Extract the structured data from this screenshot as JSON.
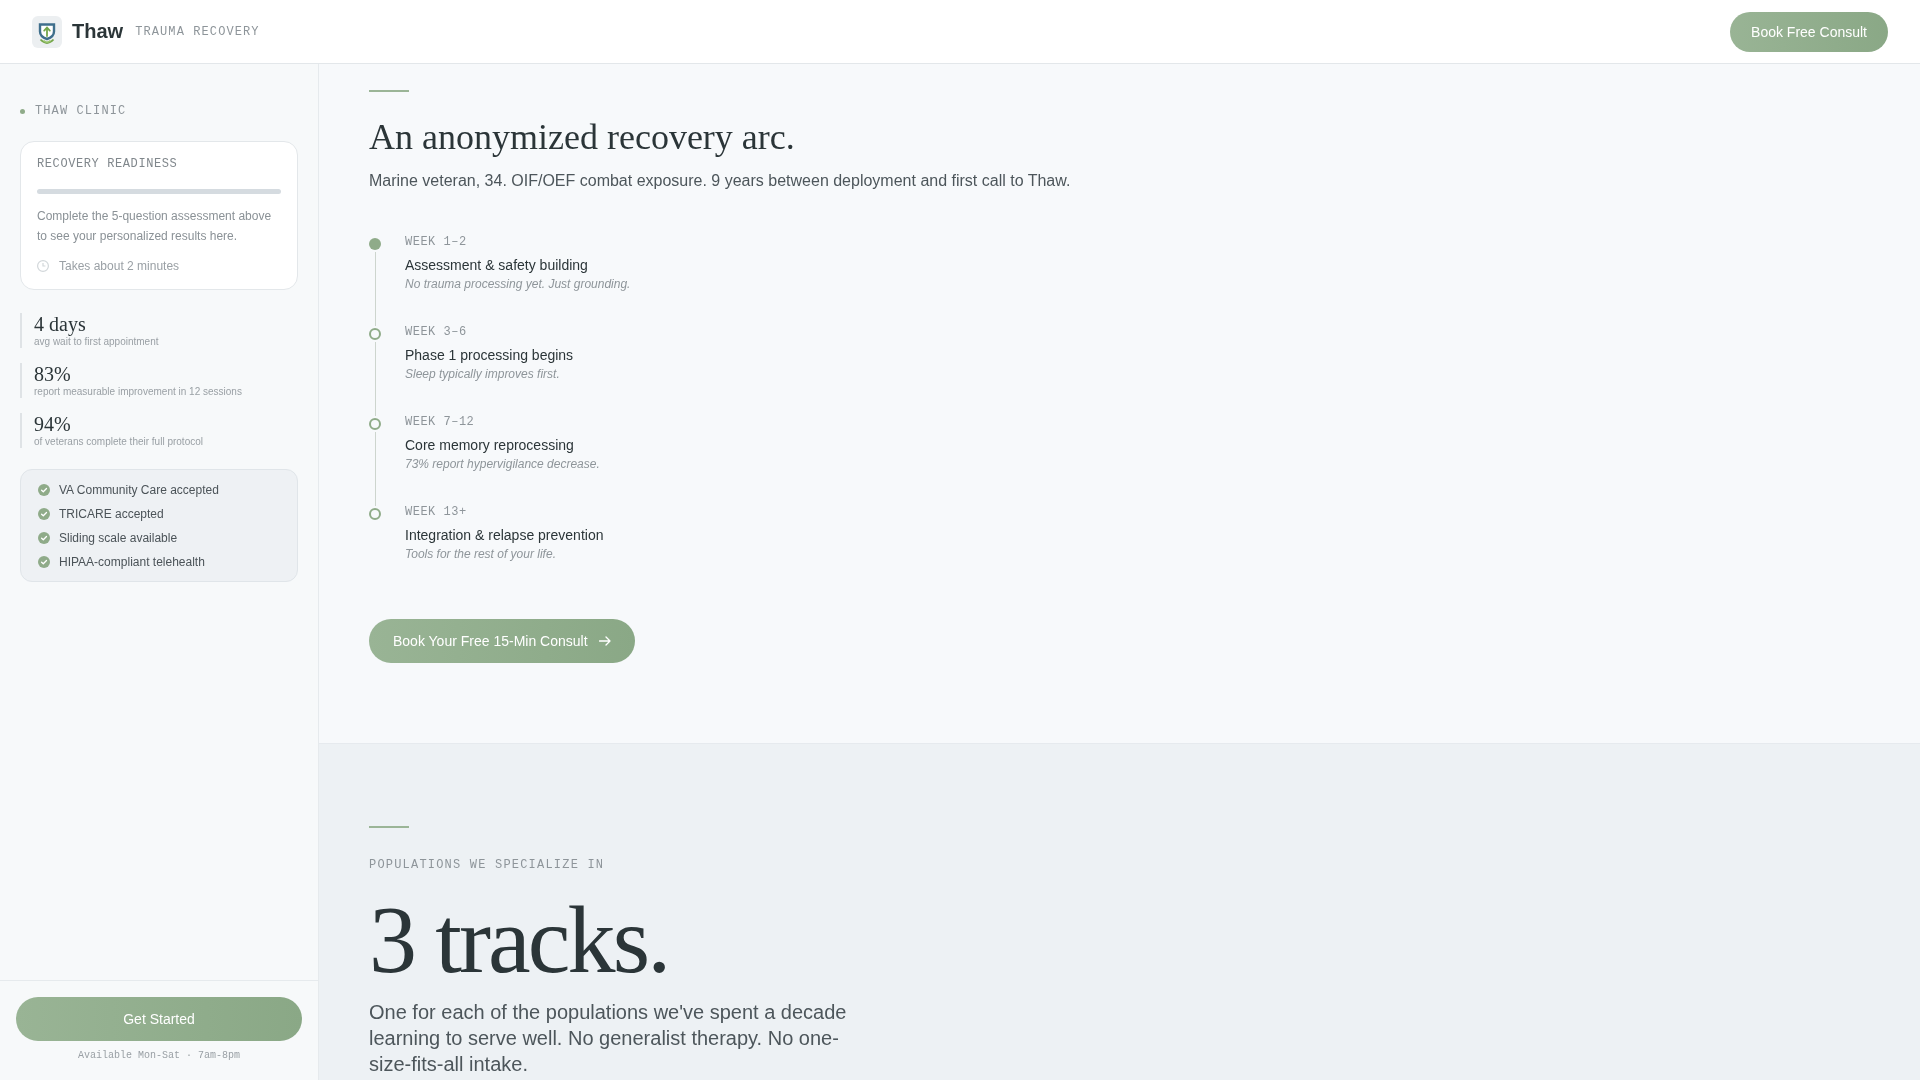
{
  "header": {
    "brand": "Thaw",
    "tagline": "TRAUMA RECOVERY",
    "cta": "Book Free Consult"
  },
  "sidebar": {
    "clinic_label": "THAW CLINIC",
    "readiness": {
      "title": "RECOVERY READINESS",
      "level": 0,
      "description": "Complete the 5-question assessment above to see your personalized results here.",
      "time_note": "Takes about 2 minutes"
    },
    "stats": [
      {
        "value": "4 days",
        "label": "avg wait to first appointment"
      },
      {
        "value": "83%",
        "label": "report measurable improvement in 12 sessions"
      },
      {
        "value": "94%",
        "label": "of veterans complete their full protocol"
      }
    ],
    "coverage": [
      {
        "label": "VA Community Care accepted",
        "checked": true
      },
      {
        "label": "TRICARE accepted",
        "checked": true
      },
      {
        "label": "Sliding scale available",
        "checked": true
      },
      {
        "label": "HIPAA-compliant telehealth",
        "checked": true
      }
    ],
    "cta": "Get Started",
    "availability": "Available Mon-Sat · 7am-8pm"
  },
  "recovery_arc": {
    "title": "An anonymized recovery arc.",
    "subtitle": "Marine veteran, 34. OIF/OEF combat exposure. 9 years between deployment and first call to Thaw.",
    "timeline": [
      {
        "week": "WEEK 1–2",
        "title": "Assessment & safety building",
        "note": "No trauma processing yet. Just grounding.",
        "active": true
      },
      {
        "week": "WEEK 3–6",
        "title": "Phase 1 processing begins",
        "note": "Sleep typically improves first.",
        "active": false
      },
      {
        "week": "WEEK 7–12",
        "title": "Core memory reprocessing",
        "note": "73% report hypervigilance decrease.",
        "active": false
      },
      {
        "week": "WEEK 13+",
        "title": "Integration & relapse prevention",
        "note": "Tools for the rest of your life.",
        "active": false
      }
    ],
    "cta": "Book Your Free 15-Min Consult"
  },
  "populations": {
    "eyebrow": "POPULATIONS WE SPECIALIZE IN",
    "title": "3 tracks.",
    "description": "One for each of the populations we've spent a decade learning to serve well. No generalist therapy. No one-size-fits-all intake."
  }
}
